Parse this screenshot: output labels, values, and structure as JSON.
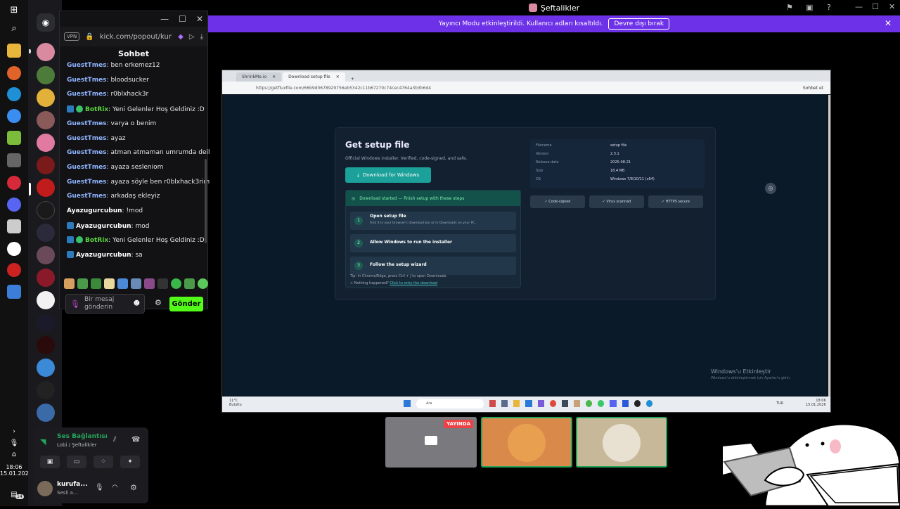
{
  "window": {
    "title": "Şeftalikler"
  },
  "banner": {
    "text": "Yayıncı Modu etkinleştirildi. Kullanıcı adları kısaltıldı.",
    "button": "Devre dışı bırak"
  },
  "chat": {
    "vpn_badge": "VPN",
    "url": "kick.com/popout/kuri",
    "header": "Sohbet",
    "messages": [
      {
        "user": "GuestTmes",
        "text": "ben erkemez12",
        "type": "guest"
      },
      {
        "user": "GuestTmes",
        "text": "bloodsucker",
        "type": "guest"
      },
      {
        "user": "GuestTmes",
        "text": "r0blxhack3r",
        "type": "guest"
      },
      {
        "user": "BotRix",
        "text": "Yeni Gelenler Hoş Geldiniz :D",
        "type": "bot"
      },
      {
        "user": "GuestTmes",
        "text": "varya o benim",
        "type": "guest"
      },
      {
        "user": "GuestTmes",
        "text": "ayaz",
        "type": "guest"
      },
      {
        "user": "GuestTmes",
        "text": "atman atmaman umrumda deil",
        "type": "guest"
      },
      {
        "user": "GuestTmes",
        "text": "ayaza sesleniom",
        "type": "guest"
      },
      {
        "user": "GuestTmes",
        "text": "ayaza söyle ben r0blxhack3rim",
        "type": "guest"
      },
      {
        "user": "GuestTmes",
        "text": "arkadaş ekleyiz",
        "type": "guest"
      },
      {
        "user": "Ayazugurcubun",
        "text": "!mod",
        "type": "ayaz"
      },
      {
        "user": "Ayazugurcubun",
        "text": "mod",
        "type": "ayaz-badge"
      },
      {
        "user": "BotRix",
        "text": "Yeni Gelenler Hoş Geldiniz :D",
        "type": "bot"
      },
      {
        "user": "Ayazugurcubun",
        "text": "sa",
        "type": "ayaz-badge"
      }
    ],
    "input_placeholder": "Bir mesaj gönderin",
    "send_button": "Gönder"
  },
  "screenshare": {
    "tab1": "ShrinkMe.io",
    "tab2": "Download setup file",
    "url": "https://getfluxfile.com/66b9d0678929756eb5342c11b67270c74cec4764a3b3b6d4",
    "sidebar_label": "Sohbet et",
    "page_title": "Get setup file",
    "page_subtitle": "Official Windows installer. Verified, code-signed, and safe.",
    "download_button": "Download for Windows",
    "status": "Download started — finish setup with these steps",
    "steps": [
      {
        "n": "1",
        "title": "Open setup file",
        "desc": "Find it in your browser's download bar or in Downloads on your PC."
      },
      {
        "n": "2",
        "title": "Allow Windows to run the installer",
        "desc": ""
      },
      {
        "n": "3",
        "title": "Follow the setup wizard",
        "desc": ""
      }
    ],
    "tip": "Tip: in Chrome/Edge, press Ctrl + J to open Downloads.",
    "nothing": "Nothing happened?",
    "retry": "Click to retry the download",
    "meta": [
      {
        "k": "Filename",
        "v": "setup file"
      },
      {
        "k": "Version",
        "v": "2.3.1"
      },
      {
        "k": "Release date",
        "v": "2025-08-21"
      },
      {
        "k": "Size",
        "v": "18.4 MB"
      },
      {
        "k": "OS",
        "v": "Windows 7/8/10/11 (x64)"
      }
    ],
    "badges": [
      "✓ Code-signed",
      "✓ Virus scanned",
      "✓ HTTPS secure"
    ],
    "activate_title": "Windows'u Etkinleştir",
    "activate_sub": "Windows'u etkinleştirmek için Ayarlar'a gidin.",
    "weather": "11°C",
    "weather_sub": "Bulutlu",
    "search": "Ara",
    "lang": "TUR",
    "time": "18:06",
    "date": "15.01.2026"
  },
  "thumbs": {
    "live_badge": "YAYINDA"
  },
  "voice": {
    "status": "Ses Bağlantısı K",
    "channel": "Lobi / Şeftalikler",
    "user": "kurufa...",
    "user_status": "Sesli a..."
  },
  "clock": {
    "time": "18:06",
    "date": "15.01.2026"
  },
  "notif_count": "14",
  "colors": {
    "accent": "#6d32e8",
    "kick": "#53fc18",
    "teal": "#1ba09a"
  }
}
